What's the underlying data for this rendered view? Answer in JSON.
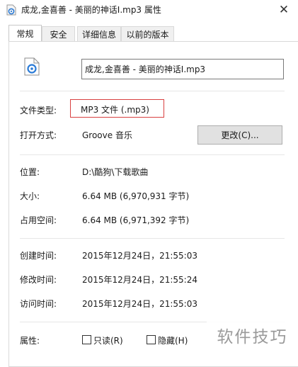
{
  "window": {
    "title": "成龙,金喜善 - 美丽的神话Ⅰ.mp3 属性",
    "close_glyph": "✕"
  },
  "tabs": [
    {
      "label": "常规",
      "active": true
    },
    {
      "label": "安全",
      "active": false
    },
    {
      "label": "详细信息",
      "active": false
    },
    {
      "label": "以前的版本",
      "active": false
    }
  ],
  "file": {
    "icon": "audio-file-icon",
    "name": "成龙,金喜善 - 美丽的神话Ⅰ.mp3"
  },
  "props": {
    "file_type_label": "文件类型:",
    "file_type_value": "MP3 文件 (.mp3)",
    "open_with_label": "打开方式:",
    "open_with_value": "Groove 音乐",
    "change_button": "更改(C)...",
    "location_label": "位置:",
    "location_value": "D:\\酷狗\\下载歌曲",
    "size_label": "大小:",
    "size_value": "6.64 MB (6,970,931 字节)",
    "size_on_disk_label": "占用空间:",
    "size_on_disk_value": "6.64 MB (6,971,392 字节)",
    "created_label": "创建时间:",
    "created_value": "2015年12月24日，21:55:03",
    "modified_label": "修改时间:",
    "modified_value": "2015年12月24日，21:55:24",
    "accessed_label": "访问时间:",
    "accessed_value": "2015年12月24日，21:55:03",
    "attributes_label": "属性:",
    "readonly_label": "只读(R)",
    "hidden_label": "隐藏(H)"
  },
  "watermark": "软件技巧",
  "colors": {
    "highlight_border": "#d94040",
    "icon_blue": "#2b7bd6"
  }
}
